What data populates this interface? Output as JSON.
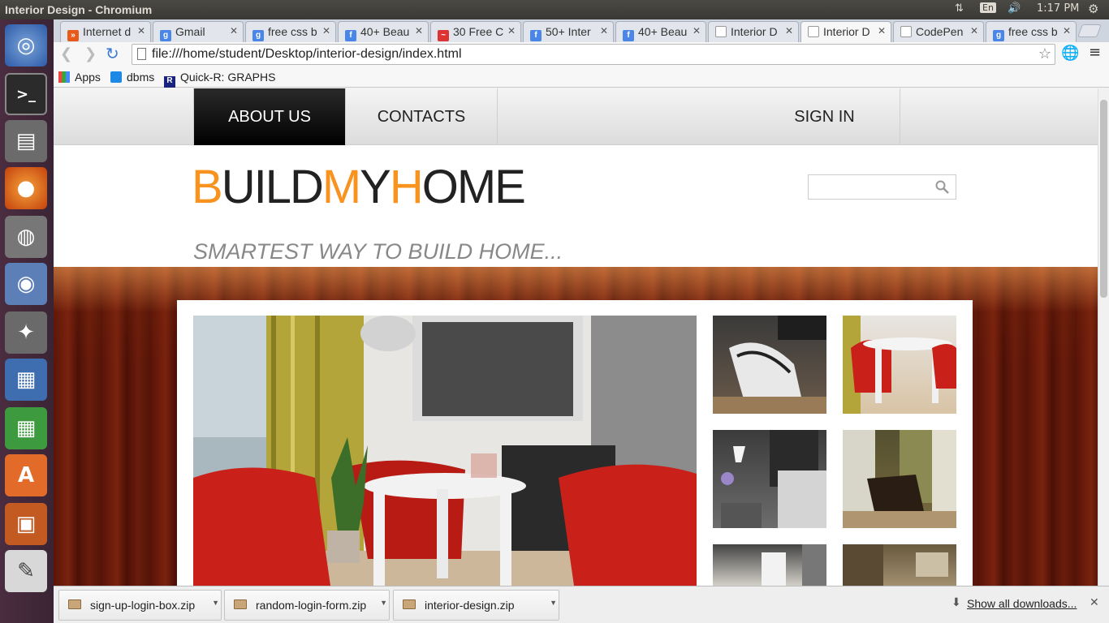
{
  "window": {
    "title": "Interior Design - Chromium"
  },
  "indicators": {
    "keyboard": "En",
    "time": "1:17 PM"
  },
  "launcher": {
    "items": [
      "ubuntu-dash",
      "terminal",
      "files",
      "firefox",
      "system-monitor",
      "chromium",
      "system-settings",
      "writer",
      "calc",
      "software-center",
      "impress",
      "text-editor"
    ]
  },
  "tabs": [
    {
      "label": "Internet d",
      "icon": "#e85a1b"
    },
    {
      "label": "Gmail",
      "icon": "#4a86e8"
    },
    {
      "label": "free css b",
      "icon": "#4a86e8"
    },
    {
      "label": "40+ Beau",
      "icon": "#4a86e8"
    },
    {
      "label": "30 Free C",
      "icon": "#d33"
    },
    {
      "label": "50+ Inter",
      "icon": "#4a86e8"
    },
    {
      "label": "40+ Beau",
      "icon": "#4a86e8"
    },
    {
      "label": "Interior D",
      "icon": "#fff"
    },
    {
      "label": "Interior D",
      "icon": "#fff"
    },
    {
      "label": "CodePen",
      "icon": "#fff"
    },
    {
      "label": "free css b",
      "icon": "#4a86e8"
    }
  ],
  "address": {
    "url": "file:///home/student/Desktop/interior-design/index.html"
  },
  "bookmarks": [
    {
      "label": "Apps"
    },
    {
      "label": "dbms"
    },
    {
      "label": "Quick-R: GRAPHS"
    }
  ],
  "site": {
    "nav": {
      "about": "ABOUT US",
      "contacts": "CONTACTS",
      "signin": "SIGN IN"
    },
    "logo": {
      "b": "B",
      "uild": "UILD",
      "m": "M",
      "y": "Y",
      "h": "H",
      "ome": "OME"
    },
    "tagline": "SMARTEST WAY TO BUILD HOME...",
    "search": {
      "placeholder": ""
    },
    "accent": "#f7931e"
  },
  "downloads": {
    "items": [
      "sign-up-login-box.zip",
      "random-login-form.zip",
      "interior-design.zip"
    ],
    "show_all": "Show all downloads..."
  }
}
